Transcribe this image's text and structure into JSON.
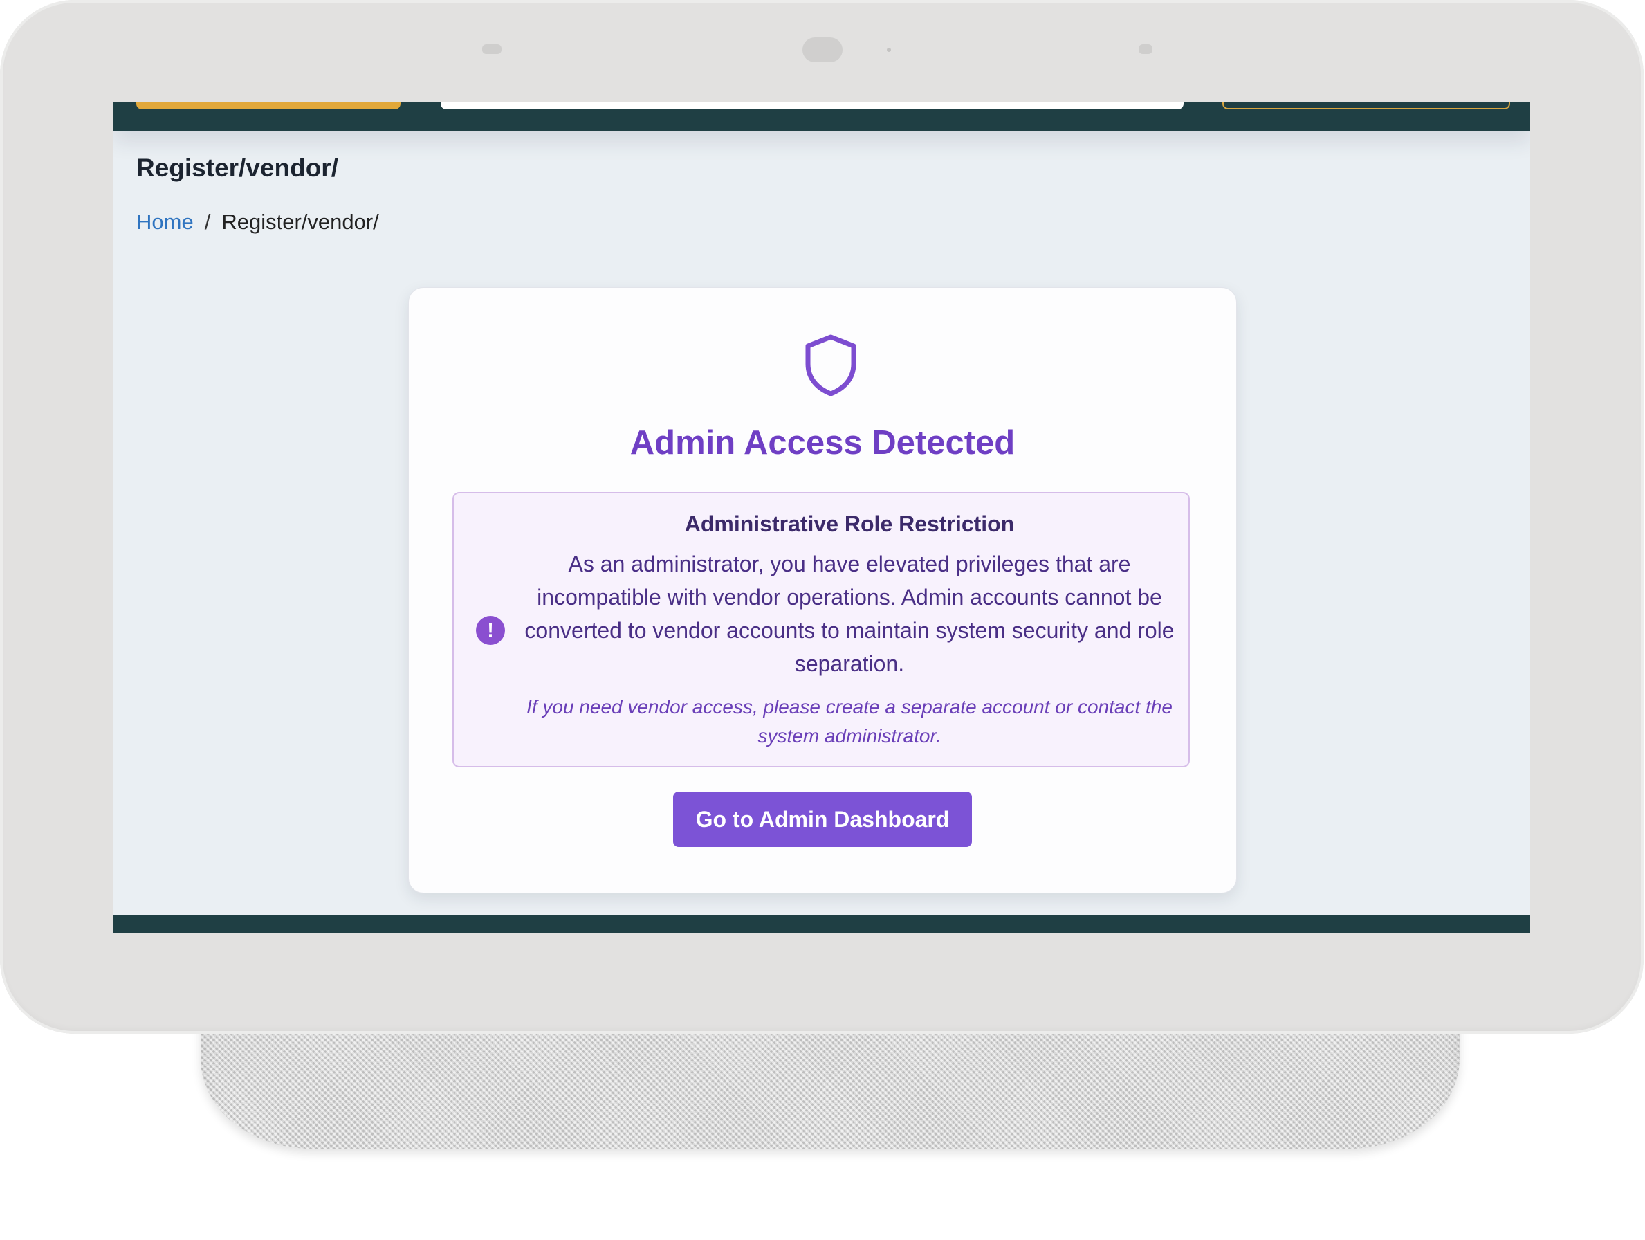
{
  "page": {
    "title": "Register/vendor/"
  },
  "breadcrumb": {
    "home": "Home",
    "separator": "/",
    "current": "Register/vendor/"
  },
  "card": {
    "icon": "shield-icon",
    "title": "Admin Access Detected",
    "notice": {
      "icon": "exclamation-circle-icon",
      "heading": "Administrative Role Restriction",
      "body": "As an administrator, you have elevated privileges that are incompatible with vendor operations. Admin accounts cannot be converted to vendor accounts to maintain system security and role separation.",
      "note": "If you need vendor access, please create a separate account or contact the system administrator."
    },
    "button_label": "Go to Admin Dashboard"
  },
  "colors": {
    "header": "#1f3f44",
    "accent": "#7c53d6",
    "title": "#6f3fc4",
    "link": "#2f74c0",
    "brand_yellow": "#e2a83a"
  }
}
